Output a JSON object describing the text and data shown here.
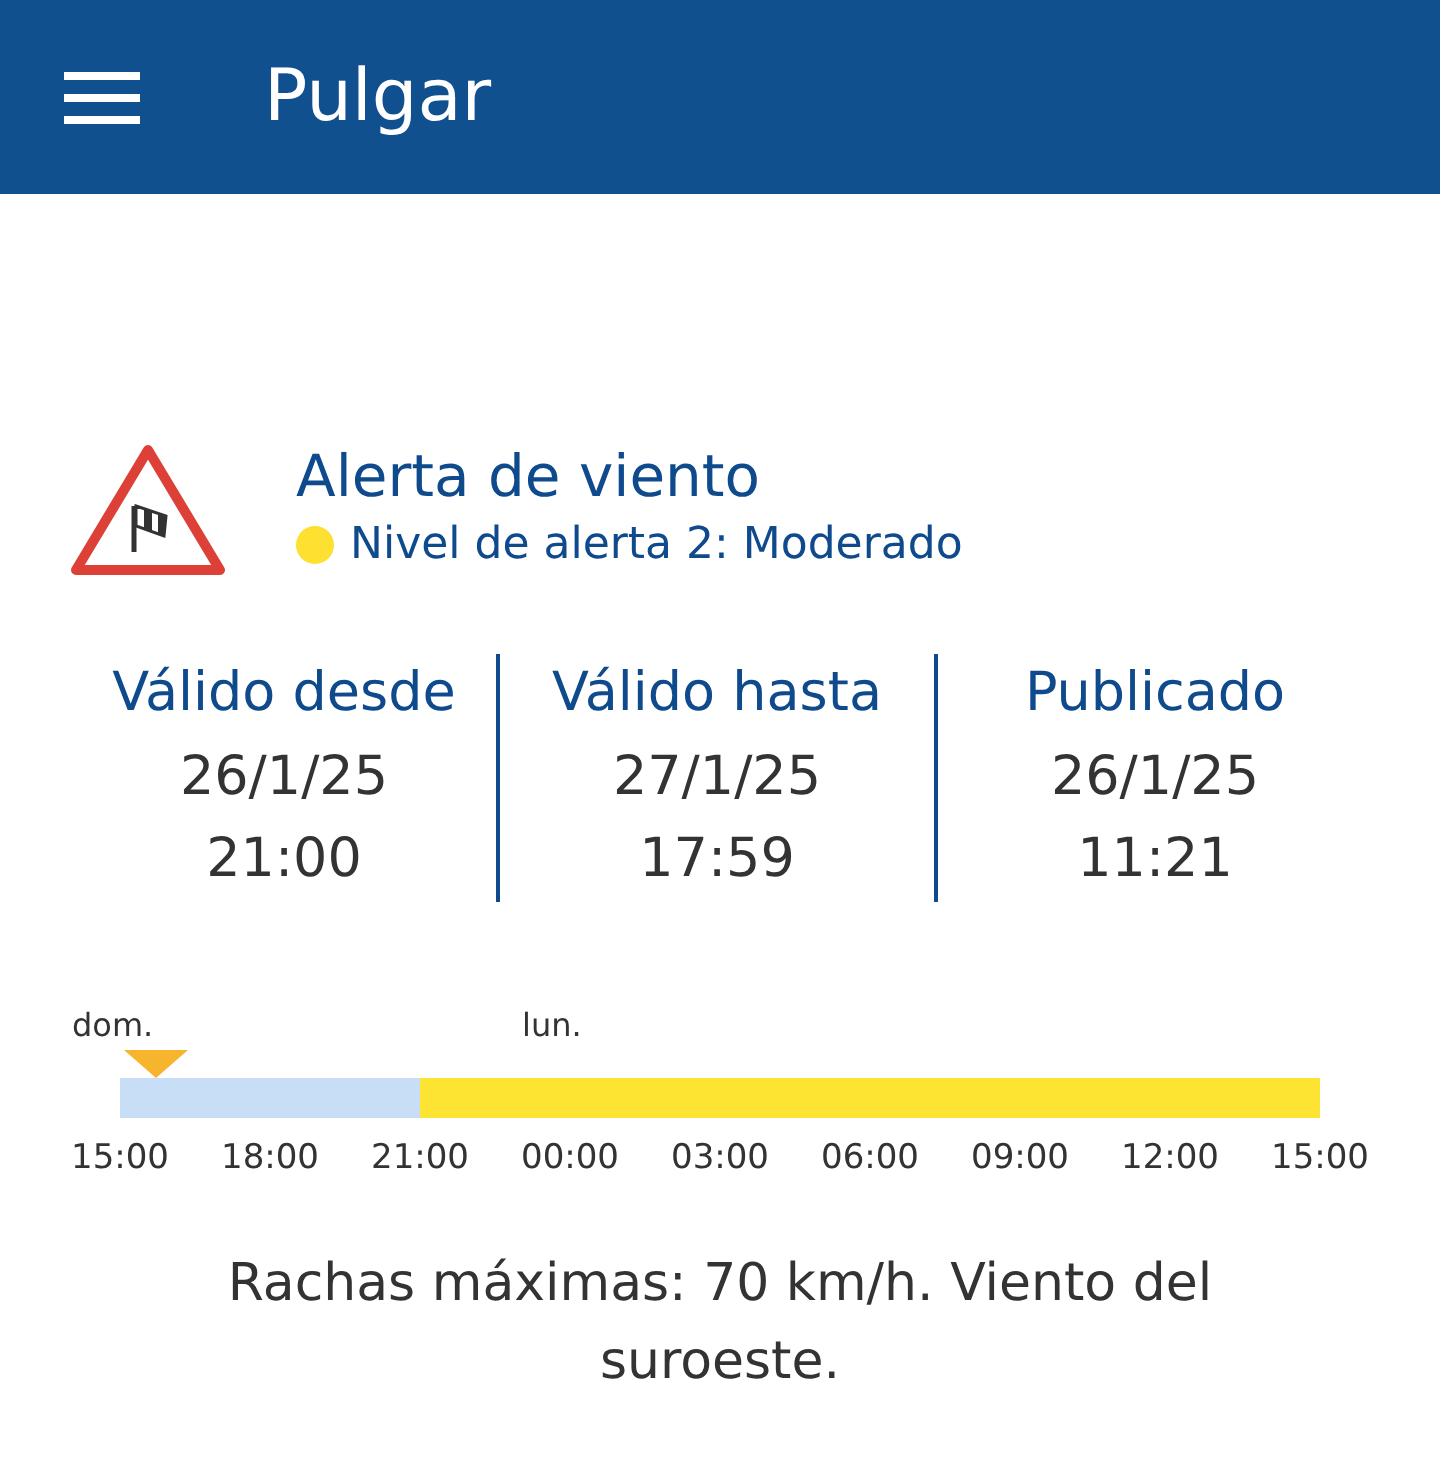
{
  "app_bar": {
    "title": "Pulgar"
  },
  "alert": {
    "title": "Alerta de viento",
    "level_label": "Nivel de alerta 2: Moderado",
    "color": "#fde030"
  },
  "validity": [
    {
      "label": "Válido desde",
      "date": "26/1/25",
      "time": "21:00"
    },
    {
      "label": "Válido hasta",
      "date": "27/1/25",
      "time": "17:59"
    },
    {
      "label": "Publicado",
      "date": "26/1/25",
      "time": "11:21"
    }
  ],
  "timeline": {
    "before_alert": {
      "level": 0.25
    },
    "ticks": [
      {
        "label": "15:00",
        "day": "dom."
      },
      {
        "label": "18:00"
      },
      {
        "label": "21:00"
      },
      {
        "label": "00:00",
        "day": "lun."
      },
      {
        "label": "03:00"
      },
      {
        "label": "06:00"
      },
      {
        "label": "09:00"
      },
      {
        "label": "12:00"
      },
      {
        "label": "15:00"
      }
    ]
  },
  "description": "Rachas máximas: 70 km/h. Viento del suroeste."
}
